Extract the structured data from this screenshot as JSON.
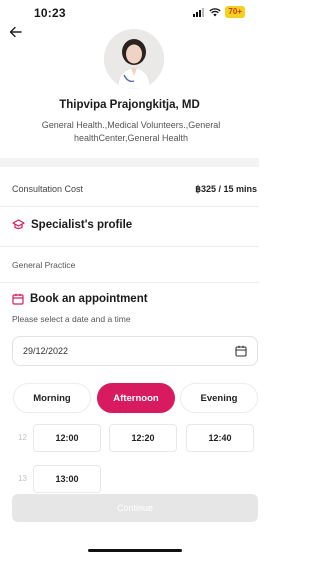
{
  "status_bar": {
    "time": "10:23",
    "battery": "70+"
  },
  "doctor": {
    "name": "Thipvipa Prajongkitja, MD",
    "specialties": "General Health.,Medical Volunteers.,General healthCenter,General Health"
  },
  "consultation": {
    "label": "Consultation Cost",
    "value": "฿325 / 15 mins"
  },
  "specialist": {
    "title": "Specialist's profile",
    "text": "General Practice"
  },
  "appointment": {
    "title": "Book an appointment",
    "subtitle": "Please select a date and a time",
    "date": "29/12/2022"
  },
  "periods": {
    "morning": "Morning",
    "afternoon": "Afternoon",
    "evening": "Evening",
    "selected": "Afternoon"
  },
  "slots": {
    "hour_12": "12",
    "hour_13": "13",
    "s1200": "12:00",
    "s1220": "12:20",
    "s1240": "12:40",
    "s1300": "13:00"
  },
  "continue_label": "Continue",
  "colors": {
    "accent": "#d81b60",
    "disabled": "#e6e6e6"
  },
  "icons": {
    "back": "arrow-left-icon",
    "specialist": "graduation-cap-icon",
    "appointment": "calendar-icon",
    "date_picker": "calendar-icon"
  }
}
